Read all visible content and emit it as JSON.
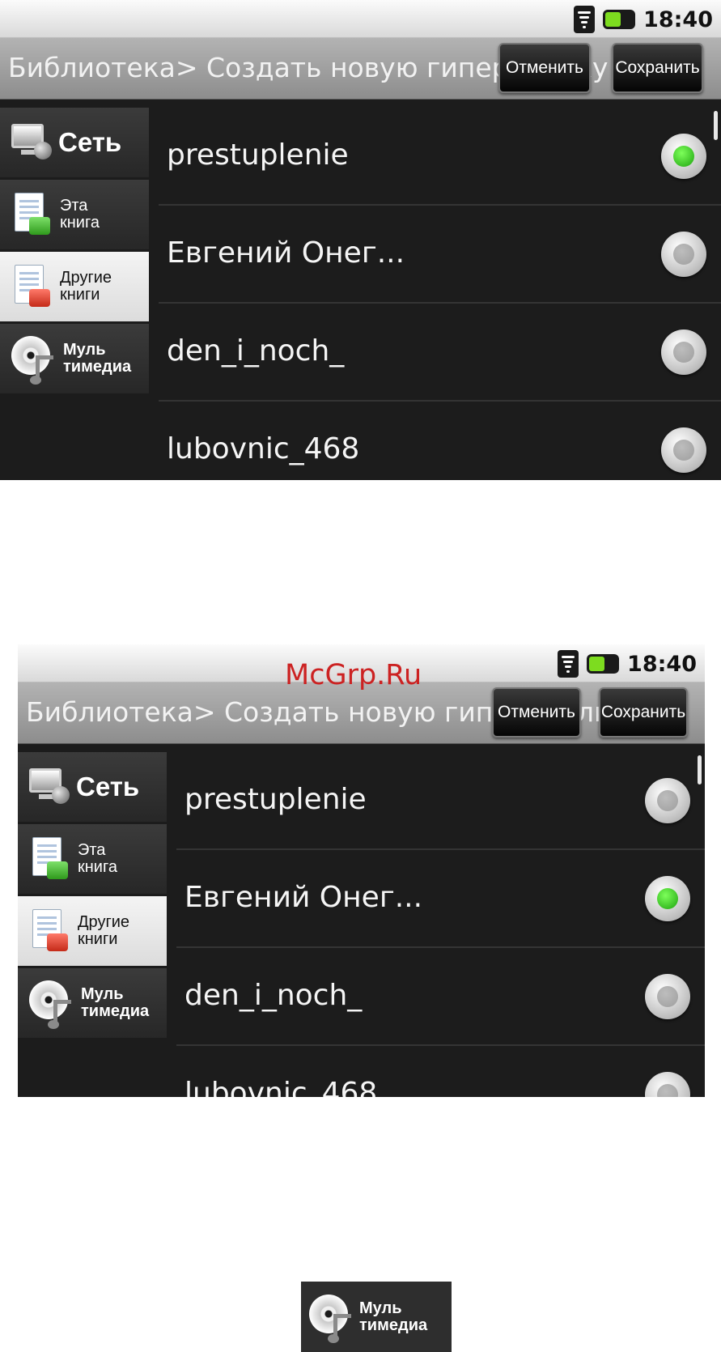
{
  "status_bar": {
    "time": "18:40"
  },
  "title_bar": {
    "title": "Библиотека> Создать новую гиперссылку",
    "cancel_label": "Отменить",
    "save_label": "Сохранить"
  },
  "sidebar": {
    "items": [
      {
        "label": "Сеть",
        "icon": "network-icon"
      },
      {
        "label": "Эта\nкнига",
        "icon": "this-book-icon"
      },
      {
        "label": "Другие\nкниги",
        "icon": "other-books-icon"
      },
      {
        "label": "Муль\nтимедиа",
        "icon": "multimedia-icon"
      }
    ],
    "selected_index": 2
  },
  "list": {
    "items": [
      {
        "label": "prestuplenie"
      },
      {
        "label": "Евгений Онег..."
      },
      {
        "label": "den_i_noch_"
      },
      {
        "label": "lubovnic_468"
      }
    ]
  },
  "screens": [
    {
      "selected_item": 0
    },
    {
      "selected_item": 1
    }
  ],
  "watermark": "McGrp.Ru",
  "crop": {
    "label": "Муль\nтимедиа"
  },
  "colors": {
    "selected_radio": "#1da30e",
    "background": "#1c1c1c"
  }
}
